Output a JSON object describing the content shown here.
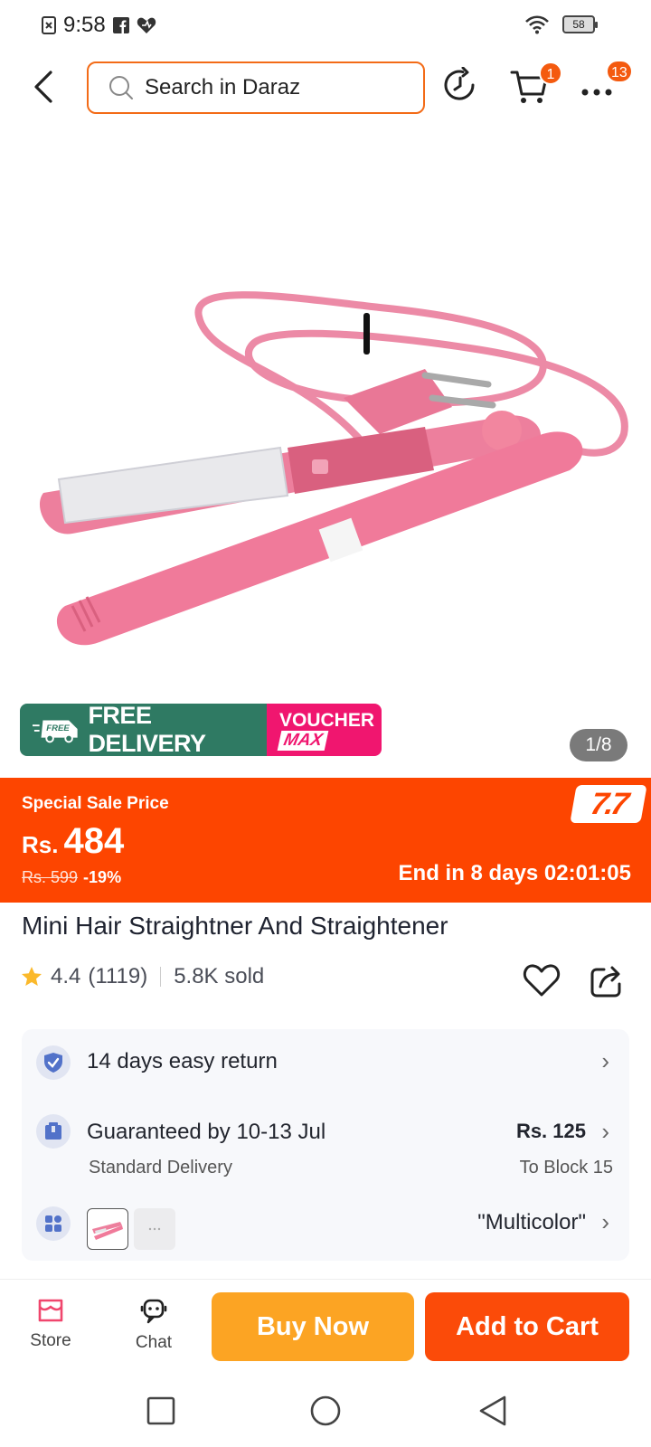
{
  "status_bar": {
    "time": "9:58",
    "battery": "58"
  },
  "header": {
    "search_placeholder": "Search in Daraz",
    "cart_badge": "1",
    "more_badge": "13"
  },
  "gallery": {
    "pager": "1/8"
  },
  "promo": {
    "free_tag": "FREE",
    "free_delivery": "FREE DELIVERY",
    "voucher_line1": "VOUCHER",
    "voucher_line2": "MAX"
  },
  "sale": {
    "label": "Special Sale Price",
    "currency": "Rs.",
    "price": "484",
    "old_price": "Rs. 599",
    "discount": "-19%",
    "countdown": "End in 8 days 02:01:05",
    "campaign_logo": "7.7"
  },
  "product": {
    "title": "Mini Hair Straightner And Straightener",
    "rating": "4.4",
    "reviews": "(1119)",
    "sold": "5.8K sold"
  },
  "info": {
    "return": "14 days easy return",
    "delivery_guarantee": "Guaranteed by 10-13 Jul",
    "delivery_type": "Standard Delivery",
    "delivery_fee": "Rs. 125",
    "delivery_to": "To Block 15",
    "variant": "\"Multicolor\""
  },
  "bottom_bar": {
    "store": "Store",
    "chat": "Chat",
    "buy_now": "Buy Now",
    "add_to_cart": "Add to Cart"
  },
  "colors": {
    "accent": "#f36b17",
    "sale_bg": "#fd4500",
    "buy_now": "#fca423",
    "add_to_cart": "#fb4b09",
    "free_delivery": "#2f7a63",
    "voucher": "#f0166f"
  }
}
